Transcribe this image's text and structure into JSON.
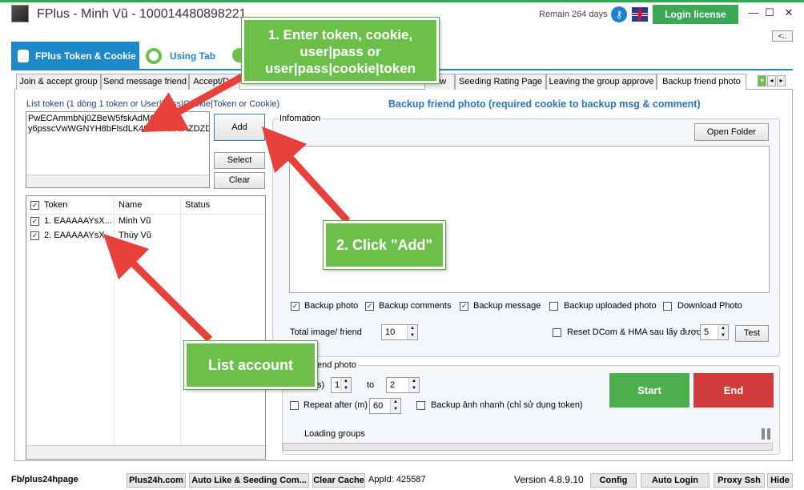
{
  "window": {
    "title": "FPlus - Minh Vũ - 100014480898221",
    "remain": "Remain 264 days",
    "login_license": "Login license",
    "minimize": "—",
    "maximize": "☐",
    "close": "✕",
    "collapse": "<.."
  },
  "main_tabs": [
    {
      "label": "FPlus Token & Cookie",
      "active": true
    },
    {
      "label": "Using Tab",
      "active": false
    }
  ],
  "sub_tabs": [
    {
      "label": "Join & accept group"
    },
    {
      "label": "Send message friend"
    },
    {
      "label": "Accept/Del"
    },
    {
      "label": "low"
    },
    {
      "label": "Seeding Rating Page"
    },
    {
      "label": "Leaving the group approve"
    },
    {
      "label": "Backup friend photo",
      "active": true
    }
  ],
  "left": {
    "list_token_label": "List token (1 dòng 1 token or User|Pass|Cookie|Token or Cookie)",
    "token_lines": "PwECAmmbNj0ZBeW5fskAdMQZDZD\ny6psscVwWGNYH8bFlsdLK40kDNWXIAZDZD",
    "add": "Add",
    "select": "Select",
    "clear": "Clear",
    "columns": [
      "Token",
      "Name",
      "Status"
    ],
    "accounts": [
      {
        "token": "1. EAAAAAYsX...",
        "name": "Minh Vũ",
        "status": "",
        "checked": true
      },
      {
        "token": "2. EAAAAAYsX...",
        "name": "Thúy Vũ",
        "status": "",
        "checked": true
      }
    ]
  },
  "right": {
    "title": "Backup friend photo (required cookie to backup msg & comment)",
    "info_label": "Infomation",
    "open_folder": "Open Folder",
    "options": [
      {
        "label": "Backup photo",
        "checked": true
      },
      {
        "label": "Backup comments",
        "checked": true
      },
      {
        "label": "Backup message",
        "checked": true
      },
      {
        "label": "Backup uploaded photo",
        "checked": false
      },
      {
        "label": "Download Photo",
        "checked": false
      }
    ],
    "total_image_label": "Total image/ friend",
    "total_image_value": "10",
    "reset_label": "Reset DCom & HMA sau lấy được",
    "reset_checked": false,
    "reset_value": "5",
    "test": "Test",
    "friend_group_label": "end photo",
    "delay_label": "s)",
    "delay_from": "1",
    "to_label": "to",
    "delay_to": "2",
    "repeat_label": "Repeat after (m)",
    "repeat_checked": false,
    "repeat_value": "60",
    "quick_backup_label": "Backup ảnh nhanh (chỉ sử dụng token)",
    "quick_backup_checked": false,
    "start": "Start",
    "end": "End",
    "loading": "Loading groups"
  },
  "status_bar": {
    "fb": "Fb/plus24hpage",
    "site": "Plus24h.com",
    "auto_like": "Auto Like & Seeding Com...",
    "clear_cache": "Clear Cache",
    "appid": "AppId: 425587",
    "version": "Version 4.8.9.10",
    "config": "Config",
    "auto_login": "Auto Login",
    "proxy": "Proxy Ssh",
    "hide": "Hide"
  },
  "annotations": {
    "step1": "1. Enter token, cookie, user|pass or user|pass|cookie|token",
    "step2": "2. Click \"Add\"",
    "list_account": "List account"
  },
  "colors": {
    "accent_blue": "#1e88c8",
    "green": "#4cae4c",
    "red": "#d03b3b",
    "callout_green": "#6cc04a",
    "arrow_red": "#e8403a"
  }
}
